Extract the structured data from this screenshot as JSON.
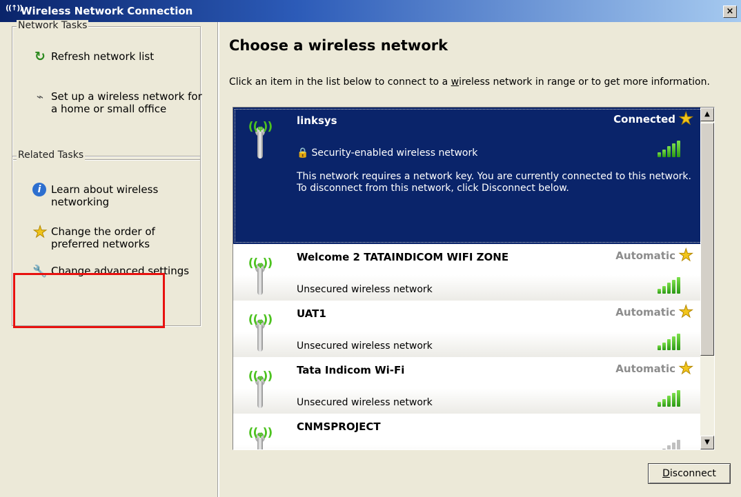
{
  "window": {
    "title": "Wireless Network Connection",
    "close_glyph": "×",
    "title_icon": "((↑))"
  },
  "left_pane": {
    "network_tasks": {
      "title": "Network Tasks",
      "items": [
        {
          "label": "Refresh network list",
          "icon": "refresh-icon",
          "glyph": "↻"
        },
        {
          "label": "Set up a wireless network for a home or small office",
          "icon": "wireless-setup-icon",
          "glyph": "⌁"
        }
      ]
    },
    "related_tasks": {
      "title": "Related Tasks",
      "items": [
        {
          "label": "Learn about wireless networking",
          "icon": "info-icon",
          "glyph": "i"
        },
        {
          "label": "Change the order of preferred networks",
          "icon": "star-icon",
          "glyph": "★"
        },
        {
          "label": "Change advanced settings",
          "icon": "wrench-icon",
          "glyph": "🔧"
        }
      ]
    },
    "highlight_color": "#e8110f"
  },
  "main": {
    "title": "Choose a wireless network",
    "instructions_pre": "Click an item in the list below to connect to a ",
    "instructions_underlined": "w",
    "instructions_post": "ireless network in range or to get more information.",
    "networks": [
      {
        "name": "linksys",
        "status": "Connected",
        "security": "Security-enabled wireless network",
        "description": "This network requires a network key. You are currently connected to this network. To disconnect from this network, click Disconnect below.",
        "selected": true,
        "signal_bars": 5
      },
      {
        "name": "Welcome 2 TATAINDICOM WIFI ZONE",
        "status": "Automatic",
        "security": "Unsecured wireless network",
        "signal_bars": 5
      },
      {
        "name": "UAT1",
        "status": "Automatic",
        "security": "Unsecured wireless network",
        "signal_bars": 5
      },
      {
        "name": "Tata Indicom Wi-Fi",
        "status": "Automatic",
        "security": "Unsecured wireless network",
        "signal_bars": 5
      },
      {
        "name": "CNMSPROJECT",
        "status": "",
        "security": "",
        "signal_bars": 2
      }
    ],
    "antenna_waves": "((ᵩ))",
    "star_glyph": "★",
    "lock_glyph": "🔒",
    "scroll_up_glyph": "▲",
    "scroll_down_glyph": "▼",
    "disconnect_underlined": "D",
    "disconnect_rest": "isconnect"
  },
  "colors": {
    "selection": "#0a246a",
    "signal": "#3fb81e",
    "star": "#f2c51c",
    "window_bg": "#ece9d8"
  }
}
